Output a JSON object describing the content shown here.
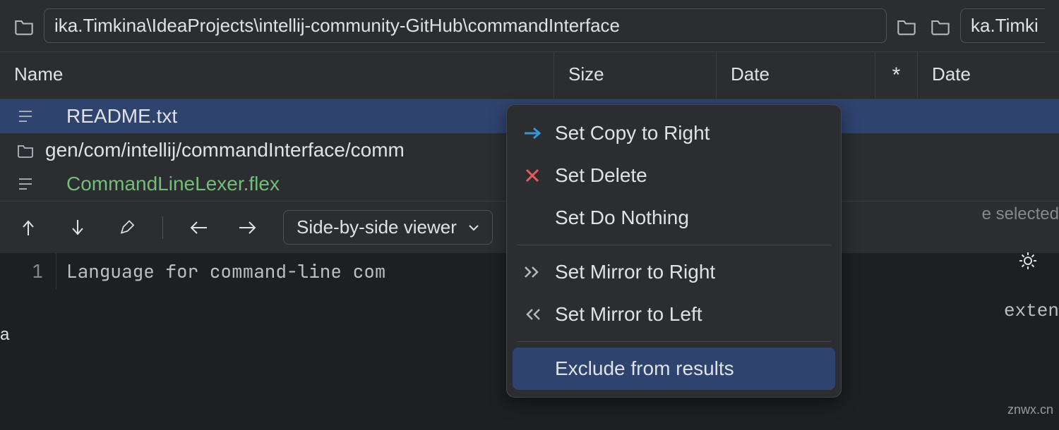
{
  "paths": {
    "left_visible": "ika.Timkina\\IdeaProjects\\intellij-community-GitHub\\commandInterface",
    "right_visible": "ka.Timki"
  },
  "columns": {
    "name": "Name",
    "size": "Size",
    "date_left": "Date",
    "star": "*",
    "date_right": "Date"
  },
  "files": [
    {
      "name": "README.txt",
      "kind": "file",
      "selected": true,
      "indent": true,
      "green": false
    },
    {
      "name": "gen/com/intellij/commandInterface/comm",
      "kind": "folder",
      "selected": false,
      "indent": false,
      "green": false
    },
    {
      "name": "CommandLineLexer.flex",
      "kind": "file",
      "selected": false,
      "indent": true,
      "green": true
    }
  ],
  "toolbar": {
    "viewer_mode": "Side-by-side viewer"
  },
  "editor": {
    "line_number": "1",
    "content_left": "Language for command-line com",
    "content_right": "exten"
  },
  "context_menu": {
    "copy_right": "Set Copy to Right",
    "delete": "Set Delete",
    "do_nothing": "Set Do Nothing",
    "mirror_right": "Set Mirror to Right",
    "mirror_left": "Set Mirror to Left",
    "exclude": "Exclude from results"
  },
  "right_hint": "e selected",
  "left_tab": "a",
  "watermark": "znwx.cn"
}
